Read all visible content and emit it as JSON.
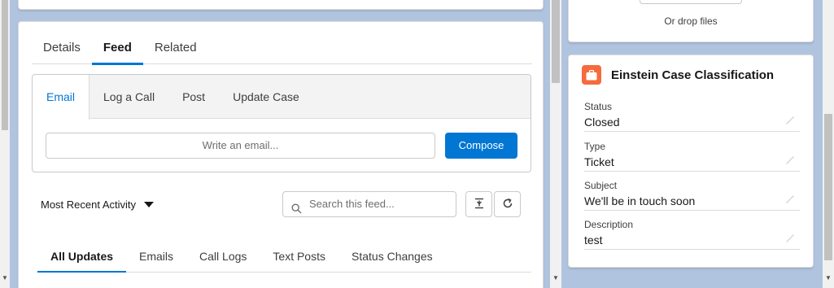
{
  "tabs": [
    "Details",
    "Feed",
    "Related"
  ],
  "active_tab": "Feed",
  "publisher": {
    "tabs": [
      "Email",
      "Log a Call",
      "Post",
      "Update Case"
    ],
    "active": "Email",
    "email_placeholder": "Write an email...",
    "compose_label": "Compose"
  },
  "feed": {
    "sort_label": "Most Recent Activity",
    "search_placeholder": "Search this feed...",
    "filters": [
      "All Updates",
      "Emails",
      "Call Logs",
      "Text Posts",
      "Status Changes"
    ],
    "active_filter": "All Updates"
  },
  "upload": {
    "drop_text": "Or drop files"
  },
  "einstein": {
    "title": "Einstein Case Classification",
    "fields": [
      {
        "label": "Status",
        "value": "Closed"
      },
      {
        "label": "Type",
        "value": "Ticket"
      },
      {
        "label": "Subject",
        "value": "We'll be in touch soon"
      },
      {
        "label": "Description",
        "value": "test"
      }
    ]
  },
  "colors": {
    "accent": "#0176d3",
    "einstein_icon": "#f66b3d",
    "background": "#b0c4df"
  }
}
